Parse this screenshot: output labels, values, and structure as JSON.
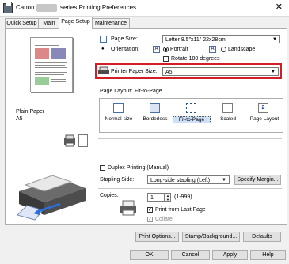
{
  "window": {
    "title_prefix": "Canon",
    "title_suffix": "series Printing Preferences",
    "close_glyph": "✕"
  },
  "tabs": [
    "Quick Setup",
    "Main",
    "Page Setup",
    "Maintenance"
  ],
  "preview": {
    "paper_type": "Plain Paper",
    "paper_size": "A5"
  },
  "page_size": {
    "label": "Page Size:",
    "value": "Letter 8.5\"x11\" 22x28cm"
  },
  "orientation": {
    "label": "Orientation:",
    "portrait": "Portrait",
    "landscape": "Landscape",
    "rotate": "Rotate 180 degrees",
    "icon_letter": "A"
  },
  "printer_paper_size": {
    "label": "Printer Paper Size:",
    "value": "A5"
  },
  "page_layout": {
    "label": "Page Layout:",
    "current": "Fit-to-Page",
    "options": [
      "Normal-size",
      "Borderless",
      "Fit-to-Page",
      "Scaled",
      "Page Layout"
    ],
    "page_layout_badge": "2"
  },
  "duplex": {
    "label": "Duplex Printing (Manual)"
  },
  "stapling": {
    "label": "Stapling Side:",
    "value": "Long-side stapling (Left)",
    "specify_margin": "Specify Margin..."
  },
  "copies": {
    "label": "Copies:",
    "value": "1",
    "range": "(1-999)",
    "print_from_last": "Print from Last Page",
    "collate": "Collate",
    "check_glyph": "✓"
  },
  "buttons": {
    "print_options": "Print Options...",
    "stamp_background": "Stamp/Background...",
    "defaults": "Defaults",
    "ok": "OK",
    "cancel": "Cancel",
    "apply": "Apply",
    "help": "Help"
  },
  "colors": {
    "highlight": "#d21f26",
    "accent": "#1e4b99"
  }
}
